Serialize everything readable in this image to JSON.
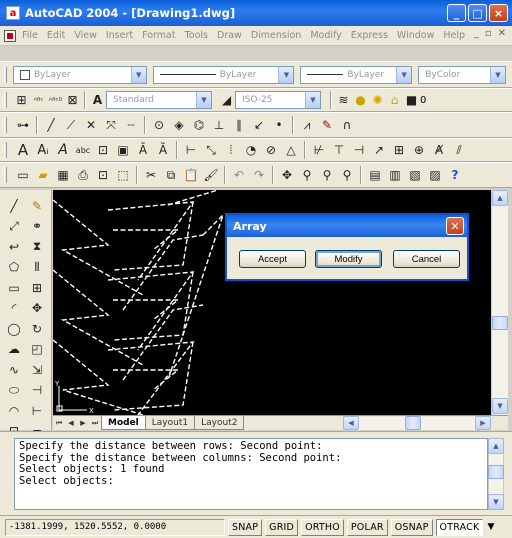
{
  "window": {
    "title": "AutoCAD 2004 - [Drawing1.dwg]",
    "min_label": "_",
    "max_label": "□",
    "close_label": "×",
    "app_icon_label": "a"
  },
  "menu": [
    "File",
    "Edit",
    "View",
    "Insert",
    "Format",
    "Tools",
    "Draw",
    "Dimension",
    "Modify",
    "Express",
    "Window",
    "Help"
  ],
  "properties_bar": {
    "layer": "ByLayer",
    "linetype": "ByLayer",
    "lineweight": "ByLayer",
    "color": "ByColor"
  },
  "styles_bar": {
    "text_style": "Standard",
    "dim_style": "ISO-25",
    "layer_value": "0"
  },
  "dialog": {
    "title": "Array",
    "accept_label": "Accept",
    "modify_label": "Modify",
    "cancel_label": "Cancel"
  },
  "tabs": [
    "Model",
    "Layout1",
    "Layout2"
  ],
  "command_lines": [
    "Specify the distance between rows:  Second point:",
    "Specify the distance between columns:  Second point:",
    "Select objects: 1 found",
    "Select objects:"
  ],
  "status": {
    "coords": "-1381.1999, 1520.5552, 0.0000",
    "buttons": [
      "SNAP",
      "GRID",
      "ORTHO",
      "POLAR",
      "OSNAP",
      "OTRACK"
    ],
    "active": "OTRACK"
  },
  "ucs": {
    "x_label": "X",
    "y_label": "Y"
  },
  "colors": {
    "titlebar": "#0a5fd8",
    "canvas": "#000000",
    "linework": "#ffffff"
  }
}
